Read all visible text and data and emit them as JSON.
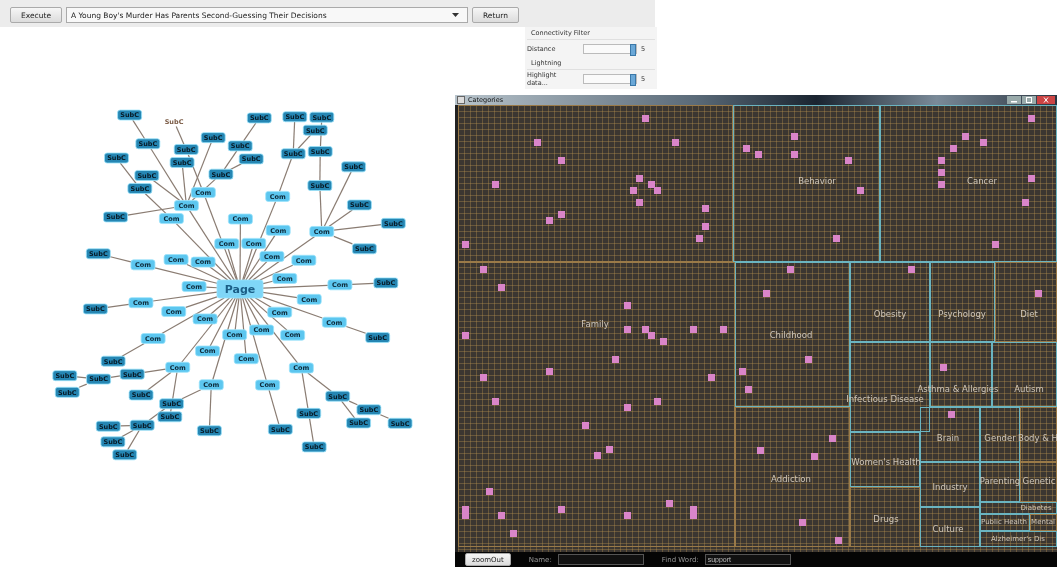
{
  "toolbar": {
    "execute_button": "Execute",
    "page_select": {
      "value": "A Young Boy's Murder Has Parents Second-Guessing Their Decisions"
    },
    "return_button": "Return"
  },
  "controls": {
    "connectivity_filter": {
      "title": "Connectivity Filter",
      "label": "Distance",
      "level": 0.95,
      "reading": "5"
    },
    "lightning": {
      "title": "Lightning",
      "label": "Highlight data...",
      "level": 0.95,
      "reading": "5"
    }
  },
  "graph": {
    "label": "Page",
    "kind": "page",
    "children": [
      {
        "label": "Com",
        "kind": "com",
        "children": [
          {
            "label": "SubC",
            "kind": "subc",
            "children": [
              {
                "label": "SubC",
                "kind": "subc",
                "children": [
                  {
                    "label": "SubC",
                    "kind": "subc"
                  }
                ]
              },
              {
                "label": "SubC",
                "kind": "subc"
              }
            ]
          },
          {
            "label": "SubC",
            "kind": "subc"
          },
          {
            "label": "SubC",
            "kind": "subc"
          },
          {
            "label": "SubC",
            "kind": "subc",
            "children": [
              {
                "label": "SubC",
                "kind": "subc"
              }
            ]
          },
          {
            "label": "SubC",
            "kind": "subc"
          },
          {
            "label": "SubC",
            "kind": "subc"
          }
        ]
      },
      {
        "label": "Com",
        "kind": "com",
        "children": [
          {
            "label": "SubC",
            "kind": "subc",
            "children": [
              {
                "label": "SubC",
                "kind": "label"
              }
            ]
          }
        ]
      },
      {
        "label": "Com",
        "kind": "com"
      },
      {
        "label": "Com",
        "kind": "com"
      },
      {
        "label": "Com",
        "kind": "com"
      },
      {
        "label": "Com",
        "kind": "com",
        "children": [
          {
            "label": "SubC",
            "kind": "subc",
            "children": [
              {
                "label": "SubC",
                "kind": "subc"
              },
              {
                "label": "SubC",
                "kind": "subc"
              }
            ]
          }
        ]
      },
      {
        "label": "Com",
        "kind": "com"
      },
      {
        "label": "Com",
        "kind": "com"
      },
      {
        "label": "Com",
        "kind": "com",
        "children": [
          {
            "label": "SubC",
            "kind": "subc",
            "children": [
              {
                "label": "SubC",
                "kind": "subc",
                "children": [
                  {
                    "label": "SubC",
                    "kind": "subc"
                  }
                ]
              }
            ]
          },
          {
            "label": "SubC",
            "kind": "subc"
          },
          {
            "label": "SubC",
            "kind": "subc"
          },
          {
            "label": "SubC",
            "kind": "subc"
          },
          {
            "label": "SubC",
            "kind": "subc"
          }
        ]
      },
      {
        "label": "Com",
        "kind": "com"
      },
      {
        "label": "Com",
        "kind": "com"
      },
      {
        "label": "Com",
        "kind": "com",
        "children": [
          {
            "label": "SubC",
            "kind": "subc"
          }
        ]
      },
      {
        "label": "Com",
        "kind": "com"
      },
      {
        "label": "Com",
        "kind": "com",
        "children": [
          {
            "label": "SubC",
            "kind": "subc"
          }
        ]
      },
      {
        "label": "Com",
        "kind": "com"
      },
      {
        "label": "Com",
        "kind": "com"
      },
      {
        "label": "Com",
        "kind": "com",
        "children": [
          {
            "label": "SubC",
            "kind": "subc",
            "children": [
              {
                "label": "SubC",
                "kind": "subc",
                "children": [
                  {
                    "label": "SubC",
                    "kind": "subc"
                  }
                ]
              },
              {
                "label": "SubC",
                "kind": "subc"
              }
            ]
          },
          {
            "label": "SubC",
            "kind": "subc",
            "children": [
              {
                "label": "SubC",
                "kind": "subc"
              }
            ]
          }
        ]
      },
      {
        "label": "Com",
        "kind": "com"
      },
      {
        "label": "Com",
        "kind": "com",
        "children": [
          {
            "label": "SubC",
            "kind": "subc"
          }
        ]
      },
      {
        "label": "Com",
        "kind": "com"
      },
      {
        "label": "Com",
        "kind": "com"
      },
      {
        "label": "Com",
        "kind": "com",
        "children": [
          {
            "label": "SubC",
            "kind": "subc",
            "children": [
              {
                "label": "SubC",
                "kind": "subc",
                "children": [
                  {
                    "label": "SubC",
                    "kind": "subc"
                  },
                  {
                    "label": "SubC",
                    "kind": "subc"
                  },
                  {
                    "label": "SubC",
                    "kind": "subc"
                  }
                ]
              }
            ]
          },
          {
            "label": "SubC",
            "kind": "subc"
          }
        ]
      },
      {
        "label": "Com",
        "kind": "com"
      },
      {
        "label": "Com",
        "kind": "com",
        "children": [
          {
            "label": "SubC",
            "kind": "subc",
            "children": [
              {
                "label": "SubC",
                "kind": "subc",
                "children": [
                  {
                    "label": "SubC",
                    "kind": "subc"
                  },
                  {
                    "label": "SubC",
                    "kind": "subc"
                  }
                ]
              }
            ]
          },
          {
            "label": "SubC",
            "kind": "subc"
          },
          {
            "label": "SubC",
            "kind": "subc"
          }
        ]
      },
      {
        "label": "Com",
        "kind": "com"
      },
      {
        "label": "Com",
        "kind": "com",
        "children": [
          {
            "label": "SubC",
            "kind": "subc"
          }
        ]
      },
      {
        "label": "Com",
        "kind": "com"
      },
      {
        "label": "Com",
        "kind": "com",
        "children": [
          {
            "label": "SubC",
            "kind": "subc"
          }
        ]
      },
      {
        "label": "Com",
        "kind": "com"
      },
      {
        "label": "Com",
        "kind": "com",
        "children": [
          {
            "label": "SubC",
            "kind": "subc"
          }
        ]
      },
      {
        "label": "Com",
        "kind": "com"
      },
      {
        "label": "Com",
        "kind": "com"
      },
      {
        "label": "Com",
        "kind": "com",
        "children": [
          {
            "label": "SubC",
            "kind": "subc",
            "children": [
              {
                "label": "SubC",
                "kind": "subc"
              }
            ]
          }
        ]
      }
    ]
  },
  "categories_window": {
    "title": "Categories",
    "categories": [
      {
        "label": "Behavior"
      },
      {
        "label": "Cancer"
      },
      {
        "label": "Family"
      },
      {
        "label": "Childhood"
      },
      {
        "label": "Obesity"
      },
      {
        "label": "Psychology"
      },
      {
        "label": "Diet"
      },
      {
        "label": "Infectious Disease"
      },
      {
        "label": "Asthma & Allergies"
      },
      {
        "label": "Autism"
      },
      {
        "label": "Women's Health"
      },
      {
        "label": "Addiction"
      },
      {
        "label": "Brain"
      },
      {
        "label": "Gender"
      },
      {
        "label": "Body & H"
      },
      {
        "label": "Industry"
      },
      {
        "label": "Parenting"
      },
      {
        "label": "Genetic"
      },
      {
        "label": "Drugs"
      },
      {
        "label": "Culture"
      },
      {
        "label": "Diabetes"
      },
      {
        "label": "Public Health"
      },
      {
        "label": "Mental"
      },
      {
        "label": "Alzheimer's Dis"
      }
    ]
  },
  "bottom_bar": {
    "button": "zoomOut",
    "name_field": {
      "label": "Name:"
    },
    "find_field": {
      "label": "Find Word:",
      "value": "support"
    }
  }
}
